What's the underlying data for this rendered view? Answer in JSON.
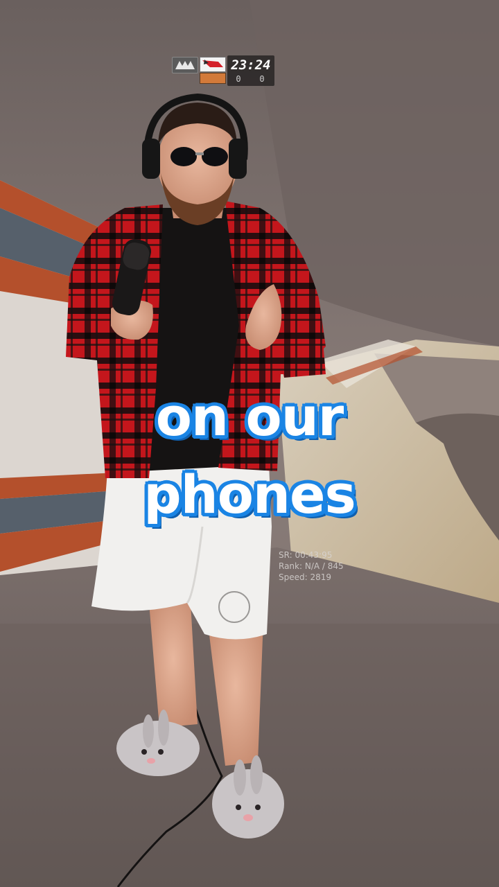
{
  "hud": {
    "team_left_logo": "team-wing-logo",
    "team_right_flag": "red-team-flag",
    "team_right_badge": "orange-team-badge",
    "timer": "23:24",
    "score_left": "0",
    "score_right": "0"
  },
  "caption": {
    "line1": "on our",
    "line2": "phones",
    "text_color": "#ffffff",
    "outline_color": "#1a84e4"
  },
  "stats": {
    "sr": "SR: 00:43:95",
    "rank": "Rank: N/A / 845",
    "speed": "Speed: 2819"
  },
  "colors": {
    "wall": "#7b6f6c",
    "floor": "#6d615e",
    "stripe_orange": "#b4502c",
    "stripe_slate": "#56606b",
    "shirt_red": "#c0181d"
  }
}
